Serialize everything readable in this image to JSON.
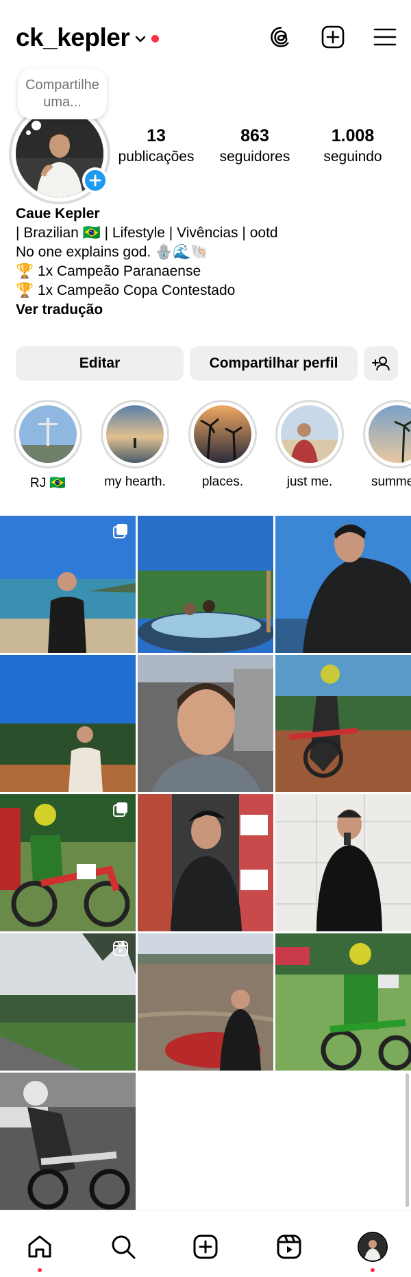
{
  "header": {
    "username": "ck_kepler",
    "icons": [
      "chevron-down-icon",
      "threads-icon",
      "create-post-icon",
      "menu-icon"
    ],
    "notification_color": "#ff3040"
  },
  "profile": {
    "note_text": "Compartilhe uma...",
    "stats": [
      {
        "value": "13",
        "label": "publicações"
      },
      {
        "value": "863",
        "label": "seguidores"
      },
      {
        "value": "1.008",
        "label": "seguindo"
      }
    ],
    "name": "Caue Kepler",
    "bio_lines": [
      "| Brazilian 🇧🇷 | Lifestyle | Vivências | ootd",
      "No one explains god. 🪬🌊🐚",
      "🏆 1x Campeão Paranaense",
      "🏆 1x Campeão Copa Contestado"
    ],
    "translate_link": "Ver tradução"
  },
  "actions": {
    "edit_label": "Editar",
    "share_label": "Compartilhar perfil",
    "discover_icon": "add-person-icon"
  },
  "highlights": [
    {
      "label": "RJ 🇧🇷"
    },
    {
      "label": "my hearth."
    },
    {
      "label": "places."
    },
    {
      "label": "just me."
    },
    {
      "label": "summe"
    }
  ],
  "grid": {
    "badges": [
      "carousel-icon",
      "carousel-icon",
      "reels-icon"
    ]
  },
  "bottom_nav": {
    "items": [
      "home-icon",
      "search-icon",
      "create-icon",
      "reels-icon",
      "profile-avatar"
    ]
  },
  "colors": {
    "accent_blue": "#1d9bf0",
    "button_bg": "#efefef",
    "ring": "#dbdbdb"
  }
}
